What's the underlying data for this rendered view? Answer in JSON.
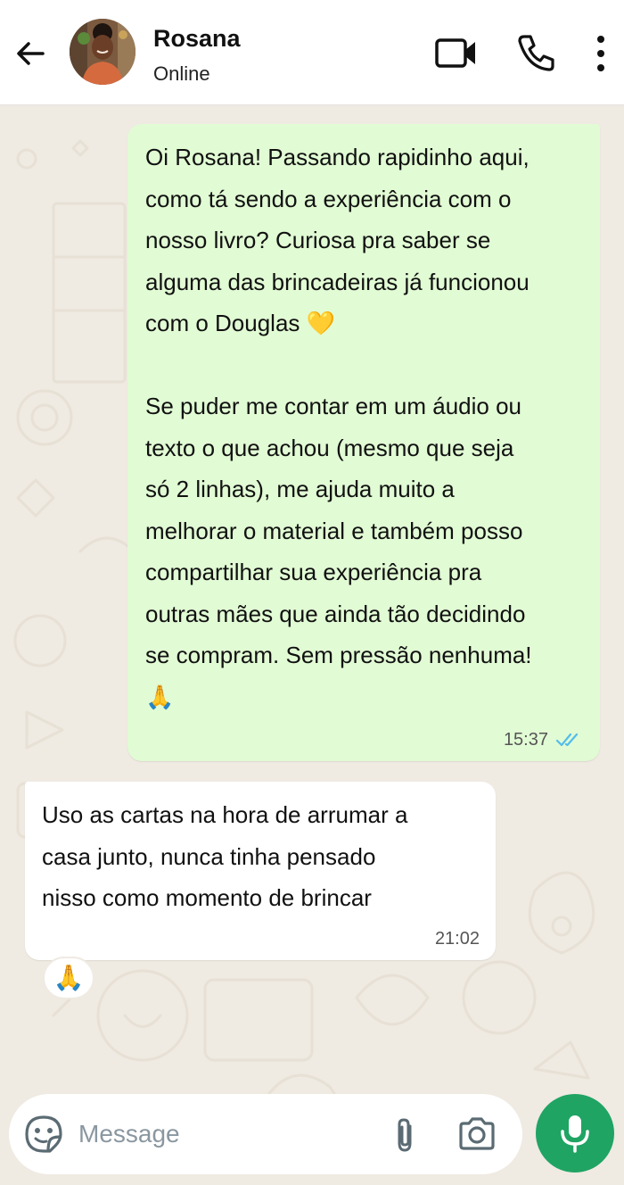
{
  "header": {
    "contact_name": "Rosana",
    "status": "Online"
  },
  "messages": [
    {
      "direction": "outgoing",
      "text": "Oi Rosana! Passando rapidinho aqui,\ncomo tá sendo a experiência com o\nnosso livro? Curiosa pra saber se\nalguma das brincadeiras já funcionou\ncom o Douglas 💛\n\nSe puder me contar em um áudio ou\ntexto o que achou (mesmo que seja\nsó 2 linhas), me ajuda muito a\nmelhorar o material e também posso\ncompartilhar sua experiência pra\noutras mães que ainda tão decidindo\nse compram. Sem pressão nenhuma!\n🙏",
      "time": "15:37",
      "read": true
    },
    {
      "direction": "incoming",
      "text": "Uso as cartas na hora de arrumar a\ncasa junto, nunca tinha pensado\nnisso como momento de brincar",
      "time": "21:02",
      "reaction": "🙏"
    }
  ],
  "composer": {
    "placeholder": "Message"
  },
  "colors": {
    "outgoing_bubble": "#e1fbd4",
    "incoming_bubble": "#ffffff",
    "read_ticks": "#53bdeb",
    "mic_button": "#1fa463",
    "wallpaper": "#efeae2"
  },
  "icons": [
    "back-arrow-icon",
    "video-call-icon",
    "phone-icon",
    "more-vert-icon",
    "double-check-icon",
    "sticker-icon",
    "paperclip-icon",
    "camera-icon",
    "mic-icon"
  ]
}
